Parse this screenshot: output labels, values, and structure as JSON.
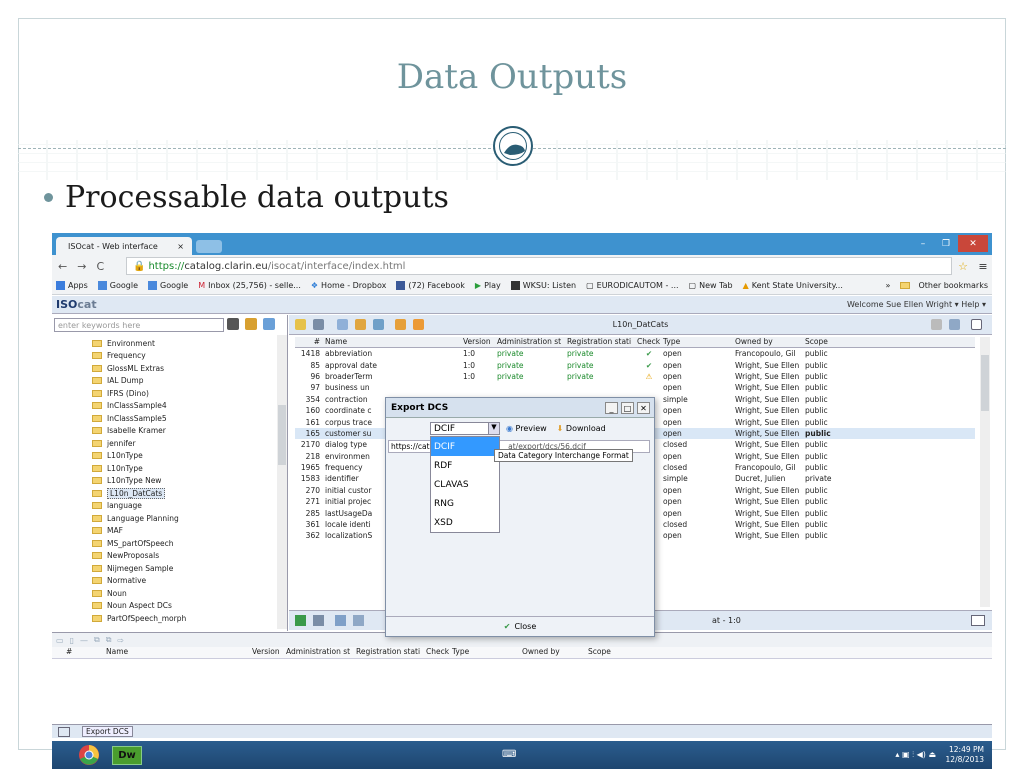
{
  "slide": {
    "title": "Data Outputs",
    "bullet": "Processable data outputs"
  },
  "browser": {
    "tab_title": "ISOcat - Web interface",
    "tab_close": "×",
    "url_https": "https://",
    "url_domain": "catalog.clarin.eu",
    "url_path": "/isocat/interface/index.html",
    "bookmarks": [
      "Apps",
      "Google",
      "Google",
      "Inbox (25,756) - selle...",
      "Home - Dropbox",
      "(72) Facebook",
      "Play",
      "WKSU: Listen",
      "EURODICAUTOM - ...",
      "New Tab",
      "Kent State University..."
    ],
    "other_bookmarks": "Other bookmarks",
    "overflow": "»"
  },
  "app": {
    "logo_main": "ISO",
    "logo_sub": "cat",
    "welcome": "Welcome Sue Ellen Wright ▾  Help ▾",
    "search_placeholder": "enter keywords here",
    "main_title": "L10n_DatCats",
    "tree": [
      "Environment",
      "Frequency",
      "GlossML Extras",
      "IAL Dump",
      "IFRS (Dino)",
      "InClassSample4",
      "InClassSample5",
      "Isabelle Kramer",
      "jennifer",
      "L10nType",
      "L10nType",
      "L10nType New",
      "L10n_DatCats",
      "language",
      "Language Planning",
      "MAF",
      "MS_partOfSpeech",
      "NewProposals",
      "Nijmegen Sample",
      "Normative",
      "Noun",
      "Noun Aspect DCs",
      "PartOfSpeech_morph"
    ],
    "columns": [
      "#",
      "Name",
      "Version",
      "Administration st",
      "Registration stati",
      "Check",
      "Type",
      "Owned by",
      "Scope"
    ],
    "rows": [
      {
        "num": "1418",
        "name": "abbreviation",
        "ver": "1:0",
        "adm": "private",
        "reg": "private",
        "chk": "✔",
        "type": "open",
        "own": "Francopoulo, Gil",
        "scope": "public"
      },
      {
        "num": "85",
        "name": "approval date",
        "ver": "1:0",
        "adm": "private",
        "reg": "private",
        "chk": "✔",
        "type": "open",
        "own": "Wright, Sue Ellen",
        "scope": "public"
      },
      {
        "num": "96",
        "name": "broaderTerm",
        "ver": "1:0",
        "adm": "private",
        "reg": "private",
        "chk": "⚠",
        "type": "open",
        "own": "Wright, Sue Ellen",
        "scope": "public"
      },
      {
        "num": "97",
        "name": "business un",
        "ver": "",
        "adm": "",
        "reg": "",
        "chk": "",
        "type": "open",
        "own": "Wright, Sue Ellen",
        "scope": "public"
      },
      {
        "num": "354",
        "name": "contraction",
        "ver": "",
        "adm": "",
        "reg": "",
        "chk": "",
        "type": "simple",
        "own": "Wright, Sue Ellen",
        "scope": "public"
      },
      {
        "num": "160",
        "name": "coordinate c",
        "ver": "",
        "adm": "",
        "reg": "",
        "chk": "",
        "type": "open",
        "own": "Wright, Sue Ellen",
        "scope": "public"
      },
      {
        "num": "161",
        "name": "corpus trace",
        "ver": "",
        "adm": "",
        "reg": "",
        "chk": "",
        "type": "open",
        "own": "Wright, Sue Ellen",
        "scope": "public"
      },
      {
        "num": "165",
        "name": "customer su",
        "ver": "",
        "adm": "",
        "reg": "",
        "chk": "",
        "type": "open",
        "own": "Wright, Sue Ellen",
        "scope": "public"
      },
      {
        "num": "2170",
        "name": "dialog type",
        "ver": "",
        "adm": "",
        "reg": "",
        "chk": "",
        "type": "closed",
        "own": "Wright, Sue Ellen",
        "scope": "public"
      },
      {
        "num": "218",
        "name": "environmen",
        "ver": "",
        "adm": "",
        "reg": "",
        "chk": "",
        "type": "open",
        "own": "Wright, Sue Ellen",
        "scope": "public"
      },
      {
        "num": "1965",
        "name": "frequency",
        "ver": "",
        "adm": "",
        "reg": "",
        "chk": "",
        "type": "closed",
        "own": "Francopoulo, Gil",
        "scope": "public"
      },
      {
        "num": "1583",
        "name": "identifier",
        "ver": "",
        "adm": "",
        "reg": "",
        "chk": "",
        "type": "simple",
        "own": "Ducret, Julien",
        "scope": "private"
      },
      {
        "num": "270",
        "name": "initial custor",
        "ver": "",
        "adm": "",
        "reg": "",
        "chk": "",
        "type": "open",
        "own": "Wright, Sue Ellen",
        "scope": "public"
      },
      {
        "num": "271",
        "name": "initial projec",
        "ver": "",
        "adm": "",
        "reg": "",
        "chk": "",
        "type": "open",
        "own": "Wright, Sue Ellen",
        "scope": "public"
      },
      {
        "num": "285",
        "name": "lastUsageDa",
        "ver": "",
        "adm": "",
        "reg": "",
        "chk": "",
        "type": "open",
        "own": "Wright, Sue Ellen",
        "scope": "public"
      },
      {
        "num": "361",
        "name": "locale identi",
        "ver": "",
        "adm": "",
        "reg": "",
        "chk": "",
        "type": "closed",
        "own": "Wright, Sue Ellen",
        "scope": "public"
      },
      {
        "num": "362",
        "name": "localizationS",
        "ver": "",
        "adm": "",
        "reg": "",
        "chk": "",
        "type": "open",
        "own": "Wright, Sue Ellen",
        "scope": "public"
      }
    ],
    "footer_text": "at - 1:0",
    "bottom_columns": [
      "#",
      "Name",
      "Version",
      "Administration st",
      "Registration stati",
      "Check",
      "Type",
      "Owned by",
      "Scope"
    ],
    "task_item": "Export DCS"
  },
  "dialog": {
    "title": "Export DCS",
    "selected_format": "DCIF",
    "preview": "Preview",
    "download": "Download",
    "url_prefix": "https://cata",
    "url_suffix": "at/export/dcs/56.dcif",
    "options": [
      "DCIF",
      "RDF",
      "CLAVAS",
      "RNG",
      "XSD"
    ],
    "tooltip": "Data Category Interchange Format",
    "close": "Close"
  },
  "taskbar": {
    "time": "12:49 PM",
    "date": "12/8/2013",
    "dw": "Dw"
  },
  "colors": {
    "title": "#6f949c",
    "chrome_blue": "#3e92cf",
    "accent_green": "#1b8a2b"
  }
}
